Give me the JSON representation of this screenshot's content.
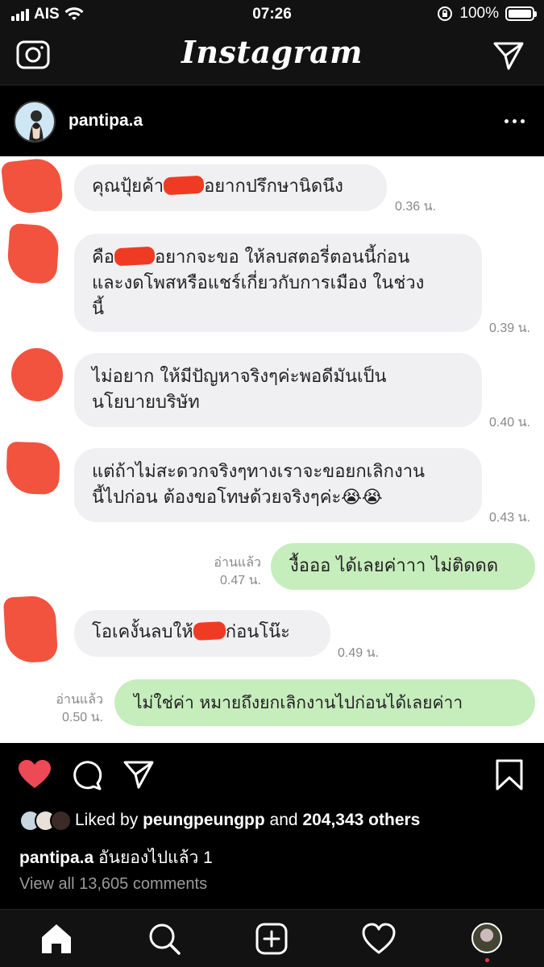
{
  "status_bar": {
    "carrier": "AIS",
    "time": "07:26",
    "battery": "100%",
    "battery_level": 1.0
  },
  "header": {
    "brand": "Instagram",
    "camera_icon": "camera-icon",
    "direct_icon": "paper-plane-icon"
  },
  "post": {
    "username": "pantipa.a",
    "more_icon": "more-horizontal-icon"
  },
  "chat": {
    "messages": [
      {
        "text_before": "คุณปุ้ยค้า",
        "text_after": "อยากปรึกษานิดนึง",
        "time": "0.36 น."
      },
      {
        "line1_before": "คือ",
        "line1_after": "อยากจะขอ ให้ลบสตอรี่ตอนนี้ก่อน",
        "line2": "และงดโพสหรือแชร์เกี่ยวกับการเมือง ในช่วง",
        "line3": "นี้",
        "time": "0.39 น."
      },
      {
        "line1": "ไม่อยาก ให้มีปัญหาจริงๆค่ะพอดีมันเป็น",
        "line2": "นโยบายบริษัท",
        "time": "0.40 น."
      },
      {
        "line1": "แต่ถ้าไม่สะดวกจริงๆทางเราจะขอยกเลิกงาน",
        "line2": "นี้ไปก่อน ต้องขอโทษด้วยจริงๆค่ะ😭😭",
        "time": "0.43 น."
      },
      {
        "text": "งื้อออ ได้เลยค่าาา ไม่ติดดด",
        "read": "อ่านแล้ว",
        "time": "0.47 น."
      },
      {
        "text_before": "โอเคงั้นลบให้",
        "text_after": "ก่อนโน๊ะ",
        "time": "0.49 น."
      },
      {
        "text": "ไม่ใช่ค่า หมายถึงยกเลิกงานไปก่อนได้เลยค่าา",
        "read": "อ่านแล้ว",
        "time": "0.50 น."
      }
    ]
  },
  "engagement": {
    "liked_by_prefix": "Liked by",
    "liked_by_user": "peungpeungpp",
    "and": "and",
    "others": "204,343 others",
    "caption_user": "pantipa.a",
    "caption_text": "อันยองไปแล้ว 1",
    "view_all": "View all 13,605 comments"
  },
  "colors": {
    "like_red": "#ed4956",
    "bubble_in": "#f0f0f3",
    "bubble_out": "#c6edbc",
    "censor_red": "#ef3b24"
  }
}
